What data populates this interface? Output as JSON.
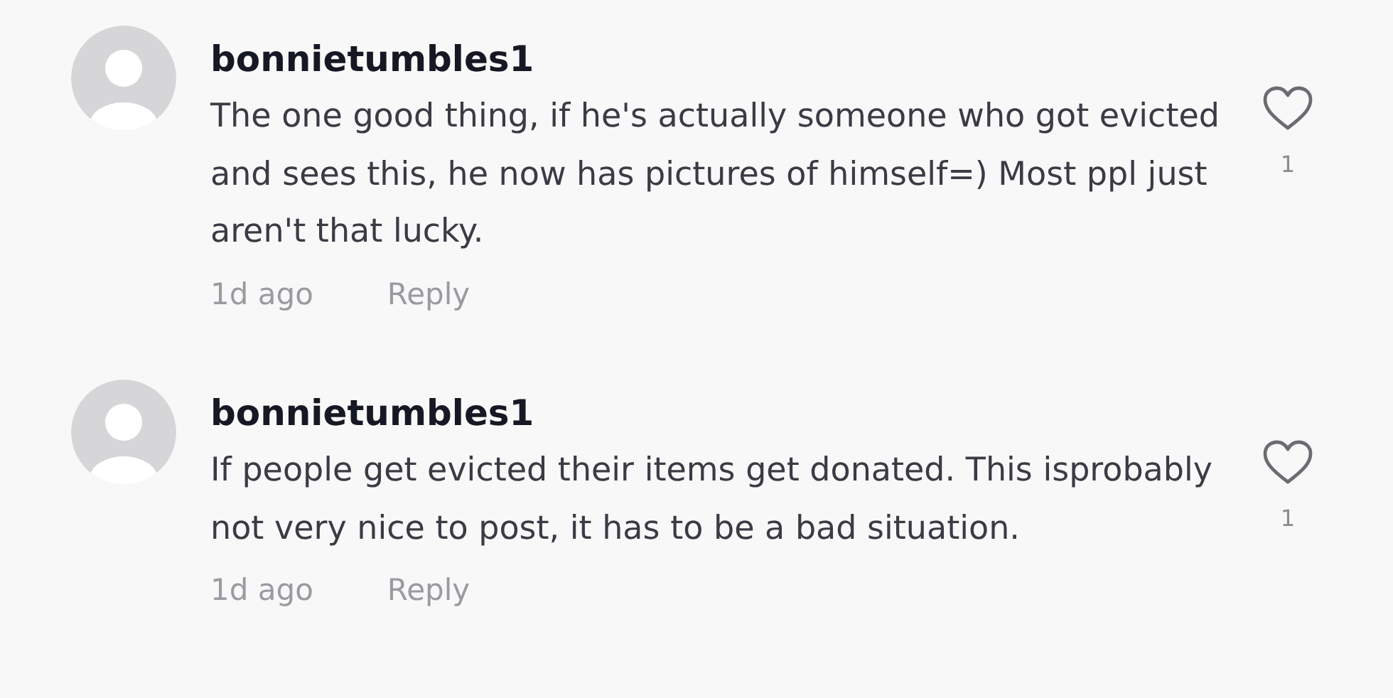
{
  "comments": [
    {
      "username": "bonnietumbles1",
      "text": "The one good thing, if he's actually someone who got evicted and sees this, he now has pictures of himself=) Most ppl just aren't that lucky.",
      "time": "1d ago",
      "reply": "Reply",
      "likes": "1"
    },
    {
      "username": "bonnietumbles1",
      "text": "If people get evicted their items get donated. This isprobably not very nice to post, it has to be a bad situation.",
      "time": "1d ago",
      "reply": "Reply",
      "likes": "1"
    }
  ]
}
